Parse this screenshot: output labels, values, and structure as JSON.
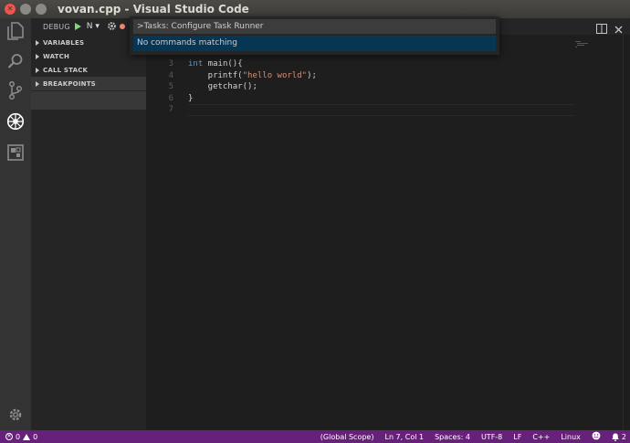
{
  "window": {
    "title": "vovan.cpp - Visual Studio Code"
  },
  "debug": {
    "label": "DEBUG",
    "config": "N",
    "sections": [
      "VARIABLES",
      "WATCH",
      "CALL STACK",
      "BREAKPOINTS"
    ]
  },
  "quick_open": {
    "input_value": ">Tasks: Configure Task Runner",
    "result": "No commands matching"
  },
  "editor": {
    "lines": [
      {
        "no": "3",
        "parts": [
          {
            "t": "int",
            "c": "kw"
          },
          {
            "t": " main(){",
            "c": ""
          }
        ]
      },
      {
        "no": "4",
        "parts": [
          {
            "t": "    printf(",
            "c": ""
          },
          {
            "t": "\"hello world\"",
            "c": "str"
          },
          {
            "t": ");",
            "c": ""
          }
        ]
      },
      {
        "no": "5",
        "parts": [
          {
            "t": "    getchar();",
            "c": ""
          }
        ]
      },
      {
        "no": "6",
        "parts": [
          {
            "t": "}",
            "c": ""
          }
        ]
      },
      {
        "no": "7",
        "parts": [
          {
            "t": "",
            "c": ""
          }
        ]
      }
    ]
  },
  "statusbar": {
    "errors": "0",
    "warnings": "0",
    "scope": "(Global Scope)",
    "position": "Ln 7, Col 1",
    "spaces": "Spaces: 4",
    "encoding": "UTF-8",
    "eol": "LF",
    "language": "C++",
    "platform": "Linux",
    "notifications": "2"
  },
  "colors": {
    "statusbar": "#68217a",
    "activitybar": "#333333",
    "sidebar": "#252526",
    "editor": "#1e1e1e",
    "selection": "#073655"
  }
}
